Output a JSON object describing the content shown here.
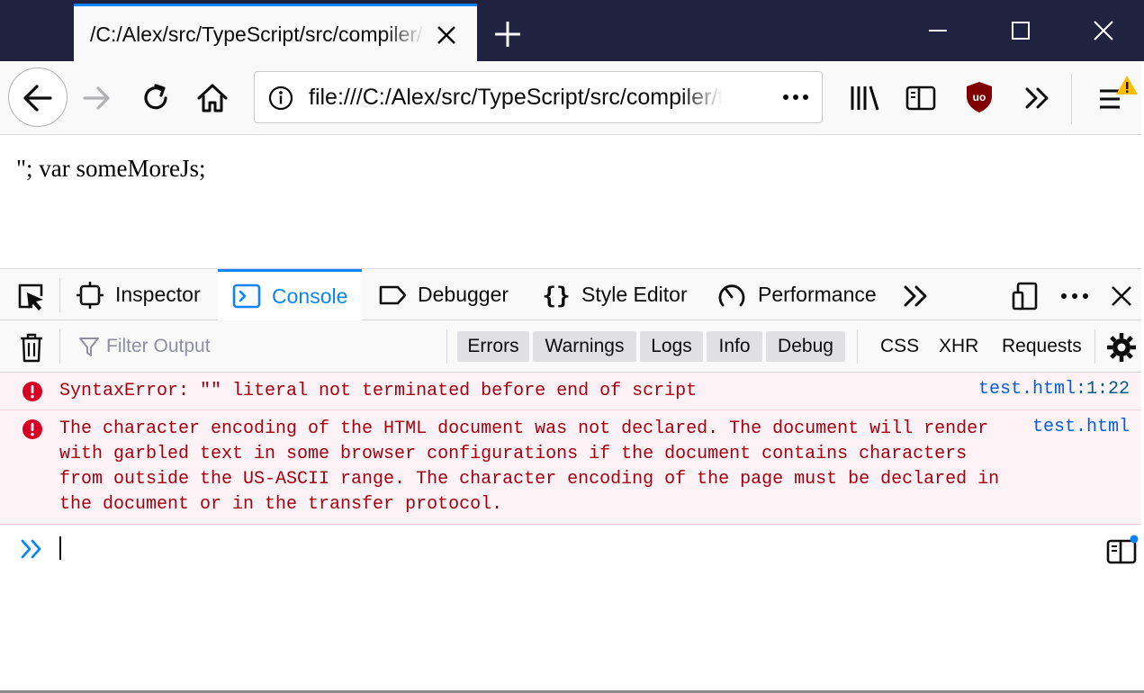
{
  "tab": {
    "title": "/C:/Alex/src/TypeScript/src/compiler/test.html"
  },
  "url": {
    "value": "file:///C:/Alex/src/TypeScript/src/compiler/test.html"
  },
  "page": {
    "content": "\"; var someMoreJs;"
  },
  "devtools": {
    "tabs": [
      {
        "label": "Inspector",
        "icon": "inspector-icon"
      },
      {
        "label": "Console",
        "icon": "console-icon"
      },
      {
        "label": "Debugger",
        "icon": "debugger-icon"
      },
      {
        "label": "Style Editor",
        "icon": "style-editor-icon"
      },
      {
        "label": "Performance",
        "icon": "performance-icon"
      }
    ],
    "active_tab": "Console"
  },
  "console": {
    "filter_placeholder": "Filter Output",
    "levels": [
      "Errors",
      "Warnings",
      "Logs",
      "Info",
      "Debug"
    ],
    "extra_filters": [
      "CSS",
      "XHR",
      "Requests"
    ],
    "messages": [
      {
        "level": "error",
        "lines": [
          "SyntaxError: \"\" literal not terminated before end of script"
        ],
        "location_file": "test.html",
        "location_pos": ":1:22"
      },
      {
        "level": "error",
        "lines": [
          "The character encoding of the HTML document was not declared. The document will render",
          "with garbled text in some browser configurations if the document contains characters",
          "from outside the US-ASCII range. The character encoding of the page must be declared in",
          "the document or in the transfer protocol."
        ],
        "location_file": "test.html"
      }
    ],
    "input_value": ""
  },
  "colors": {
    "titlebar": "#202340",
    "accent": "#0a84ff",
    "error_text": "#a4000f",
    "error_bg": "#fdf2f5",
    "link": "#0060df"
  }
}
